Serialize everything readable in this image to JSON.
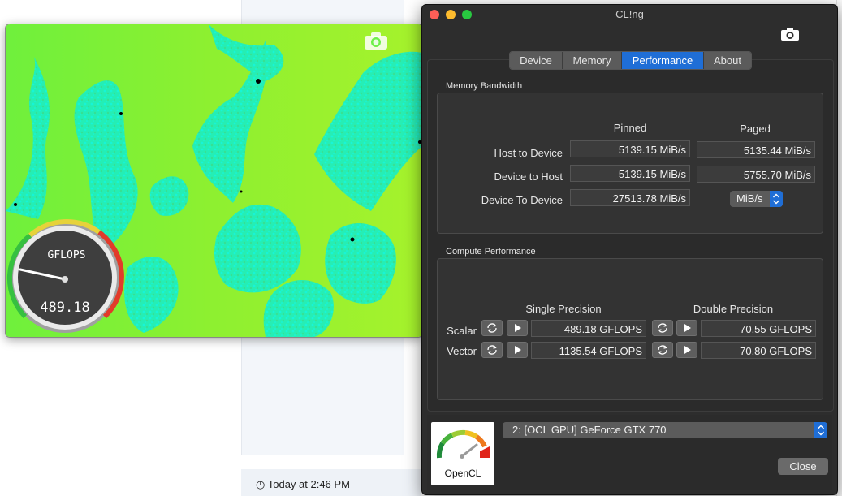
{
  "background": {
    "timestamp": "Today at 2:46 PM"
  },
  "fractal_window": {
    "gauge": {
      "label": "GFLOPS",
      "value": "489.18"
    }
  },
  "cling_window": {
    "title": "CL!ng",
    "tabs": [
      {
        "label": "Device"
      },
      {
        "label": "Memory"
      },
      {
        "label": "Performance",
        "active": true
      },
      {
        "label": "About"
      }
    ],
    "memory_bandwidth": {
      "section_title": "Memory Bandwidth",
      "col_pinned": "Pinned",
      "col_paged": "Paged",
      "rows": [
        {
          "label": "Host to Device",
          "pinned": "5139.15 MiB/s",
          "paged": "5135.44 MiB/s"
        },
        {
          "label": "Device to Host",
          "pinned": "5139.15 MiB/s",
          "paged": "5755.70 MiB/s"
        },
        {
          "label": "Device To Device",
          "pinned": "27513.78 MiB/s"
        }
      ],
      "unit_select": "MiB/s"
    },
    "compute_performance": {
      "section_title": "Compute Performance",
      "col_single": "Single Precision",
      "col_double": "Double Precision",
      "rows": [
        {
          "label": "Scalar",
          "single": "489.18 GFLOPS",
          "double": "70.55 GFLOPS"
        },
        {
          "label": "Vector",
          "single": "1135.54 GFLOPS",
          "double": "70.80 GFLOPS"
        }
      ]
    },
    "logo_label": "OpenCL",
    "device_select": "2: [OCL GPU] GeForce GTX 770",
    "close_label": "Close"
  },
  "colors": {
    "accent": "#1f6ed6",
    "window_bg": "#2d2d2d",
    "fractal_green": "#6ef04a",
    "fractal_cyan": "#19f0c8"
  }
}
